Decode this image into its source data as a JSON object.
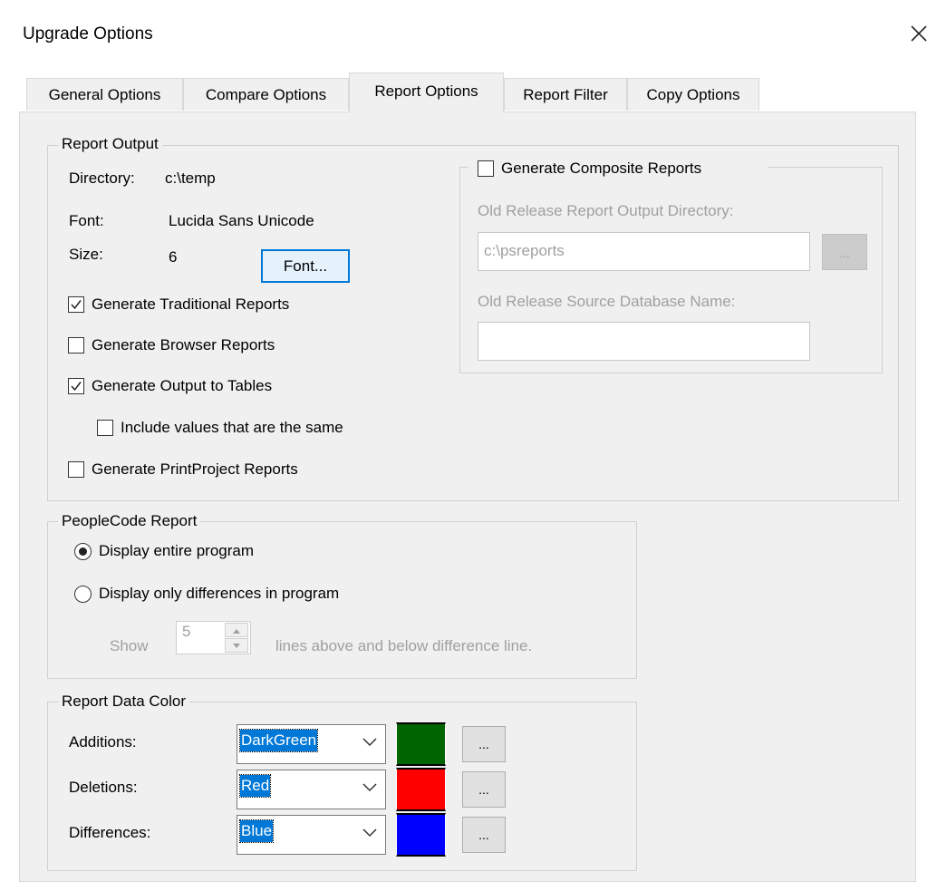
{
  "window": {
    "title": "Upgrade Options",
    "close_icon": "close-icon"
  },
  "tabs": [
    {
      "label": "General Options",
      "active": false
    },
    {
      "label": "Compare Options",
      "active": false
    },
    {
      "label": "Report Options",
      "active": true
    },
    {
      "label": "Report Filter",
      "active": false
    },
    {
      "label": "Copy Options",
      "active": false
    }
  ],
  "report_output": {
    "legend": "Report Output",
    "directory_label": "Directory:",
    "directory_value": "c:\\temp",
    "font_label": "Font:",
    "font_value": "Lucida Sans Unicode",
    "size_label": "Size:",
    "size_value": "6",
    "font_button": "Font...",
    "traditional": {
      "label": "Generate Traditional Reports",
      "checked": true
    },
    "browser": {
      "label": "Generate Browser Reports",
      "checked": false
    },
    "tables": {
      "label": "Generate Output to Tables",
      "checked": true
    },
    "include_same": {
      "label": "Include values that are the same",
      "checked": false
    },
    "printproject": {
      "label": "Generate PrintProject Reports",
      "checked": false
    }
  },
  "composite": {
    "checkbox_label": "Generate Composite Reports",
    "checked": false,
    "old_dir_label": "Old Release Report Output Directory:",
    "old_dir_value": "c:\\psreports",
    "browse_label": "...",
    "old_db_label": "Old Release Source Database Name:",
    "old_db_value": ""
  },
  "peoplecode": {
    "legend": "PeopleCode Report",
    "entire_label": "Display entire program",
    "diff_label": "Display only differences in program",
    "selected": "entire",
    "show_label": "Show",
    "show_value": "5",
    "lines_label": "lines above and below difference line."
  },
  "colors": {
    "legend": "Report Data Color",
    "rows": [
      {
        "label": "Additions:",
        "value": "DarkGreen",
        "swatch": "#006400",
        "button": "..."
      },
      {
        "label": "Deletions:",
        "value": "Red",
        "swatch": "#ff0000",
        "button": "..."
      },
      {
        "label": "Differences:",
        "value": "Blue",
        "swatch": "#0000ff",
        "button": "..."
      }
    ]
  }
}
